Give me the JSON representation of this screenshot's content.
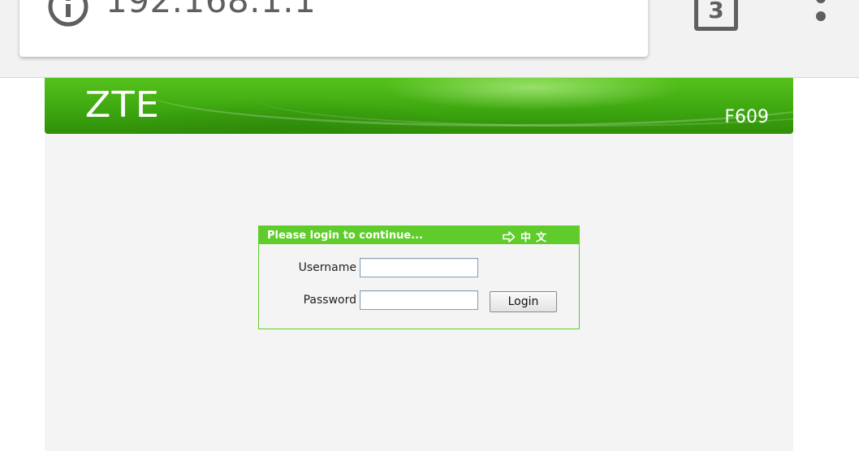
{
  "browser": {
    "url": "192.168.1.1",
    "tab_count": "3",
    "info_icon": "info-icon",
    "menu_icon": "kebab-menu-icon"
  },
  "banner": {
    "logo_text": "ZTE",
    "model": "F609"
  },
  "login": {
    "title": "Please login to continue...",
    "language_link": "中文",
    "language_icon": "arrow-right-icon",
    "username_label": "Username",
    "username_value": "",
    "password_label": "Password",
    "password_value": "",
    "login_button": "Login"
  },
  "colors": {
    "banner_green": "#3ea810",
    "login_header_green": "#5fcc2c",
    "page_background": "#f4f4f4",
    "chrome_icon_gray": "#5f5f5f"
  }
}
